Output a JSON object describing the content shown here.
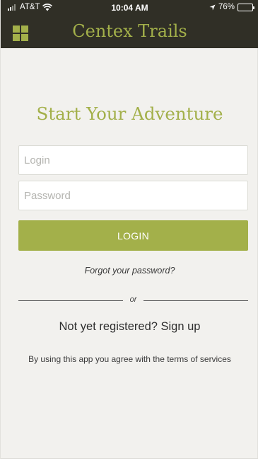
{
  "status_bar": {
    "carrier": "AT&T",
    "time": "10:04 AM",
    "battery": "76%",
    "battery_level": 0.76
  },
  "header": {
    "title": "Centex Trails",
    "menu_icon": "grid-menu-icon"
  },
  "main": {
    "headline": "Start Your Adventure",
    "login_placeholder": "Login",
    "password_placeholder": "Password",
    "login_button": "LOGIN",
    "forgot_password": "Forgot your password?",
    "divider_text": "or",
    "signup_text": "Not yet registered? Sign up",
    "terms_text": "By using this app you agree with the terms of services"
  },
  "colors": {
    "accent": "#a3b04a",
    "header_bg": "#302f26",
    "page_bg": "#f2f1ee"
  }
}
